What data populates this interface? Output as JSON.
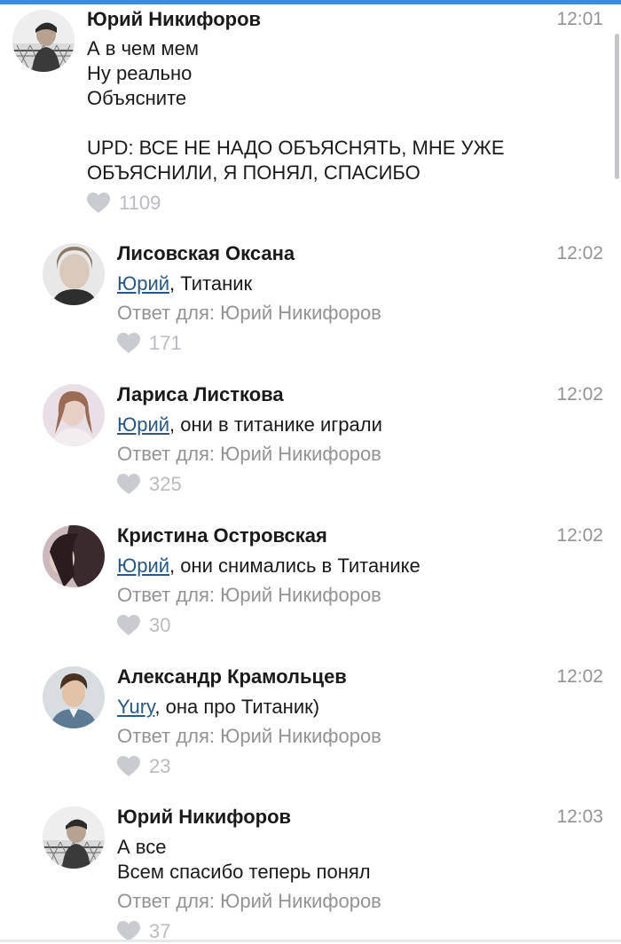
{
  "comments": [
    {
      "author": "Юрий Никифоров",
      "time": "12:01",
      "text": "А в чем мем\nНу реально\nОбъясните\n\nUPD: ВСЕ НЕ НАДО ОБЪЯСНЯТЬ, МНЕ УЖЕ ОБЪЯСНИЛИ, Я ПОНЯЛ, СПАСИБО",
      "likes": "1109"
    },
    {
      "author": "Лисовская Оксана",
      "time": "12:02",
      "mention": "Юрий",
      "text": ", Титаник",
      "reply_to": "Ответ для: Юрий Никифоров",
      "likes": "171"
    },
    {
      "author": "Лариса Листкова",
      "time": "12:02",
      "mention": "Юрий",
      "text": ", они в титанике играли",
      "reply_to": "Ответ для: Юрий Никифоров",
      "likes": "325"
    },
    {
      "author": "Кристина Островская",
      "time": "12:02",
      "mention": "Юрий",
      "text": ", они снимались в Титанике",
      "reply_to": "Ответ для: Юрий Никифоров",
      "likes": "30"
    },
    {
      "author": "Александр Крамольцев",
      "time": "12:02",
      "mention": "Yury",
      "text": ", она про Титаник)",
      "reply_to": "Ответ для: Юрий Никифоров",
      "likes": "23"
    },
    {
      "author": "Юрий Никифоров",
      "time": "12:03",
      "text": "А все\nВсем спасибо теперь понял",
      "reply_to": "Ответ для: Юрий Никифоров",
      "likes": "37"
    }
  ],
  "icons": {
    "like": "heart-icon"
  },
  "colors": {
    "accent": "#3f8ae0",
    "mention": "#2a5885",
    "secondary_text": "#939393",
    "like_icon": "#c8ccd1"
  }
}
